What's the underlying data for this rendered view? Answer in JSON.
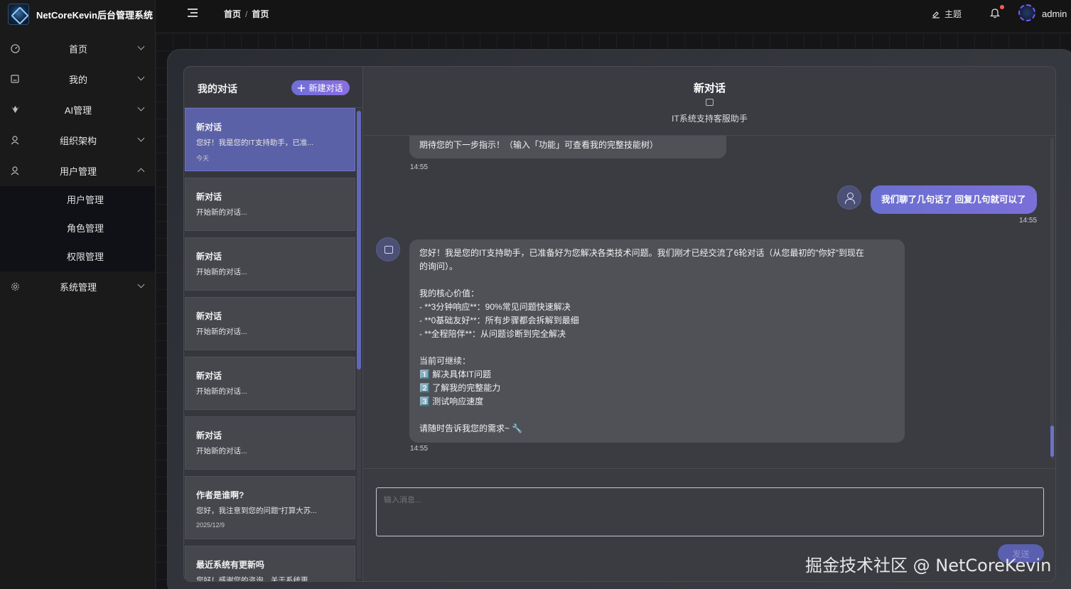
{
  "brand": {
    "title": "NetCoreKevin后台管理系统"
  },
  "sidebar": {
    "items": [
      {
        "label": "首页",
        "icon": "dashboard-icon"
      },
      {
        "label": "我的",
        "icon": "profile-icon"
      },
      {
        "label": "AI管理",
        "icon": "ai-icon"
      },
      {
        "label": "组织架构",
        "icon": "user-icon"
      },
      {
        "label": "用户管理",
        "icon": "user-icon"
      },
      {
        "label": "系统管理",
        "icon": "gear-icon"
      }
    ],
    "submenu": [
      "用户管理",
      "角色管理",
      "权限管理"
    ]
  },
  "header": {
    "breadcrumb": [
      "首页",
      "首页"
    ],
    "theme_label": "主题",
    "username": "admin"
  },
  "conversations": {
    "title": "我的对话",
    "new_button": "新建对话",
    "items": [
      {
        "title": "新对话",
        "preview": "您好！我是您的IT支持助手，已准...",
        "time": "今天",
        "active": true
      },
      {
        "title": "新对话",
        "preview": "开始新的对话..."
      },
      {
        "title": "新对话",
        "preview": "开始新的对话..."
      },
      {
        "title": "新对话",
        "preview": "开始新的对话..."
      },
      {
        "title": "新对话",
        "preview": "开始新的对话..."
      },
      {
        "title": "新对话",
        "preview": "开始新的对话..."
      },
      {
        "title": "作者是谁啊?",
        "preview": "您好，我注意到您的问题\"打算大苏...",
        "time": "2025/12/9"
      },
      {
        "title": "最近系统有更新吗",
        "preview": "您好！感谢您的咨询。关于系统更..."
      }
    ]
  },
  "chat": {
    "title": "新对话",
    "subtitle": "IT系统支持客服助手",
    "messages": {
      "bot1_text": "期待您的下一步指示！（输入「功能」可查看我的完整技能树）",
      "bot1_time": "14:55",
      "user1_text": "我们聊了几句话了 回复几句就可以了",
      "user1_time": "14:55",
      "bot2_lines": [
        "您好！我是您的IT支持助手，已准备好为您解决各类技术问题。我们刚才已经交流了6轮对话（从您最初的\"你好\"到现在",
        "的询问）。",
        "",
        "我的核心价值：",
        "- **3分钟响应**：90%常见问题快速解决",
        "- **0基础友好**：所有步骤都会拆解到最细",
        "- **全程陪伴**：从问题诊断到完全解决",
        "",
        "当前可继续：",
        "1️⃣ 解决具体IT问题",
        "2️⃣ 了解我的完整能力",
        "3️⃣ 测试响应速度",
        "",
        "请随时告诉我您的需求~ 🔧"
      ],
      "bot2_time": "14:55"
    },
    "input_placeholder": "输入消息...",
    "send_label": "发送"
  },
  "watermark": "掘金技术社区 @ NetCoreKevin"
}
